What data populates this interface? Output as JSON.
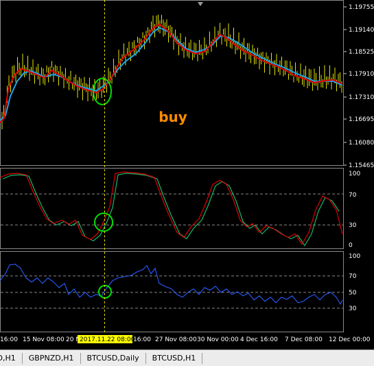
{
  "main_chart": {
    "price_labels": [
      "1.19755",
      "1.19140",
      "1.18525",
      "1.17910",
      "1.17310",
      "1.16695",
      "1.16080",
      "1.15465"
    ],
    "annotation": "buy",
    "colors": {
      "ma_fast": "#e00000",
      "ma_slow": "#1ca3e8",
      "candles": "#e6e600",
      "cross_circle": "#00e000",
      "annotation": "#ff8c00",
      "grid": "#606060"
    }
  },
  "stochastic": {
    "levels": [
      "100",
      "70",
      "30",
      "0"
    ],
    "colors": {
      "main": "#e00000",
      "signal": "#15b86c"
    }
  },
  "rsi": {
    "levels": [
      "100",
      "70",
      "50",
      "30"
    ],
    "color": "#2a5cff"
  },
  "time_axis": {
    "labels": [
      "16:00",
      "15 Nov 08:00",
      "20 N",
      "16:00",
      "27 Nov 08:00",
      "30 Nov 00:00",
      "4 Dec 16:00",
      "7 Dec 08:00",
      "12 Dec 00:00"
    ],
    "crosshair_label": "2017.11.22 08:00"
  },
  "symbol_tabs": [
    "ZD,H1",
    "GBPNZD,H1",
    "BTCUSD,Daily",
    "BTCUSD,H1"
  ]
}
